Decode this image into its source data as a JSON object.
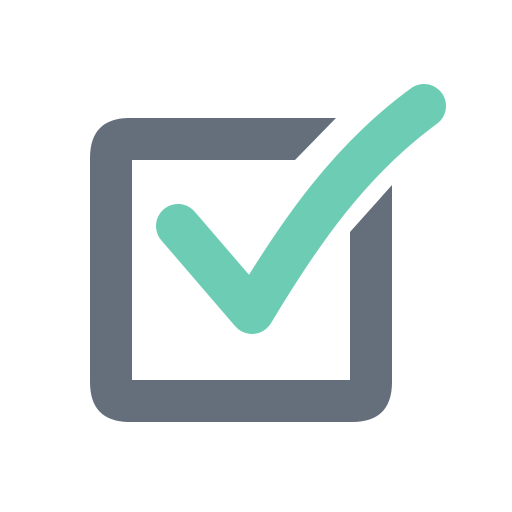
{
  "icon": {
    "name": "checked-checkbox-icon",
    "box_color": "#646f7b",
    "check_color": "#6ccdb4",
    "background_color": "#ffffff"
  }
}
